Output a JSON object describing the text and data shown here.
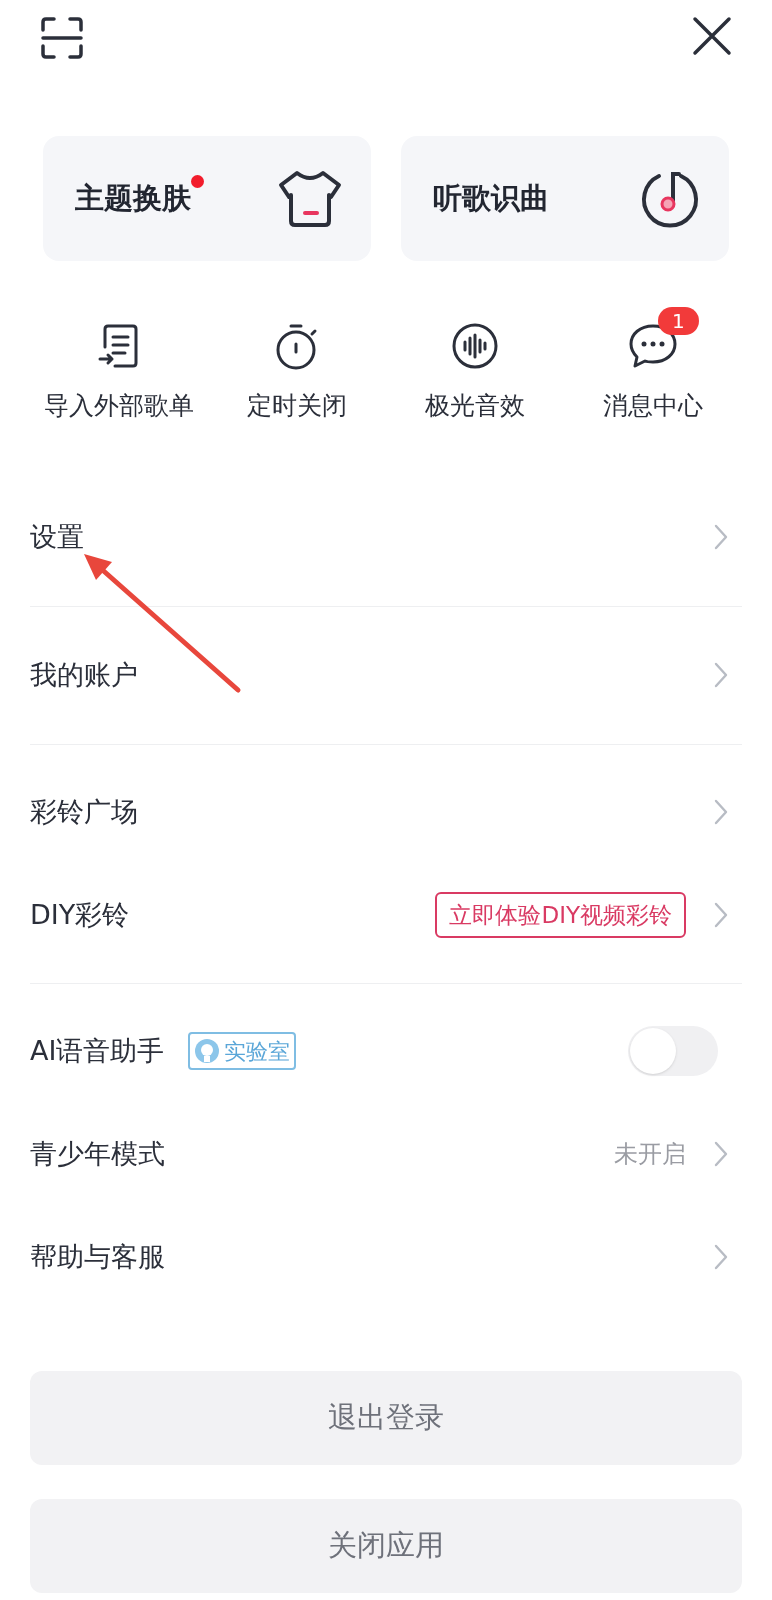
{
  "cards": [
    {
      "label": "主题换肤",
      "dot": true,
      "kind": "shirt"
    },
    {
      "label": "听歌识曲",
      "dot": false,
      "kind": "note"
    }
  ],
  "shortcuts": [
    {
      "label": "导入外部歌单",
      "kind": "import"
    },
    {
      "label": "定时关闭",
      "kind": "timer"
    },
    {
      "label": "极光音效",
      "kind": "wave"
    },
    {
      "label": "消息中心",
      "kind": "chat",
      "badge": "1"
    }
  ],
  "groups": [
    {
      "rows": [
        {
          "kind": "link",
          "label": "设置"
        }
      ]
    },
    {
      "rows": [
        {
          "kind": "link",
          "label": "我的账户"
        }
      ]
    },
    {
      "rows": [
        {
          "kind": "link",
          "label": "彩铃广场"
        },
        {
          "kind": "link_tag",
          "label": "DIY彩铃",
          "tag": "立即体验DIY视频彩铃"
        }
      ]
    },
    {
      "rows": [
        {
          "kind": "switch",
          "label": "AI语音助手",
          "tag": "实验室",
          "on": false
        },
        {
          "kind": "link_value",
          "label": "青少年模式",
          "value": "未开启"
        },
        {
          "kind": "link",
          "label": "帮助与客服"
        }
      ]
    }
  ],
  "buttons": [
    "退出登录",
    "关闭应用"
  ]
}
